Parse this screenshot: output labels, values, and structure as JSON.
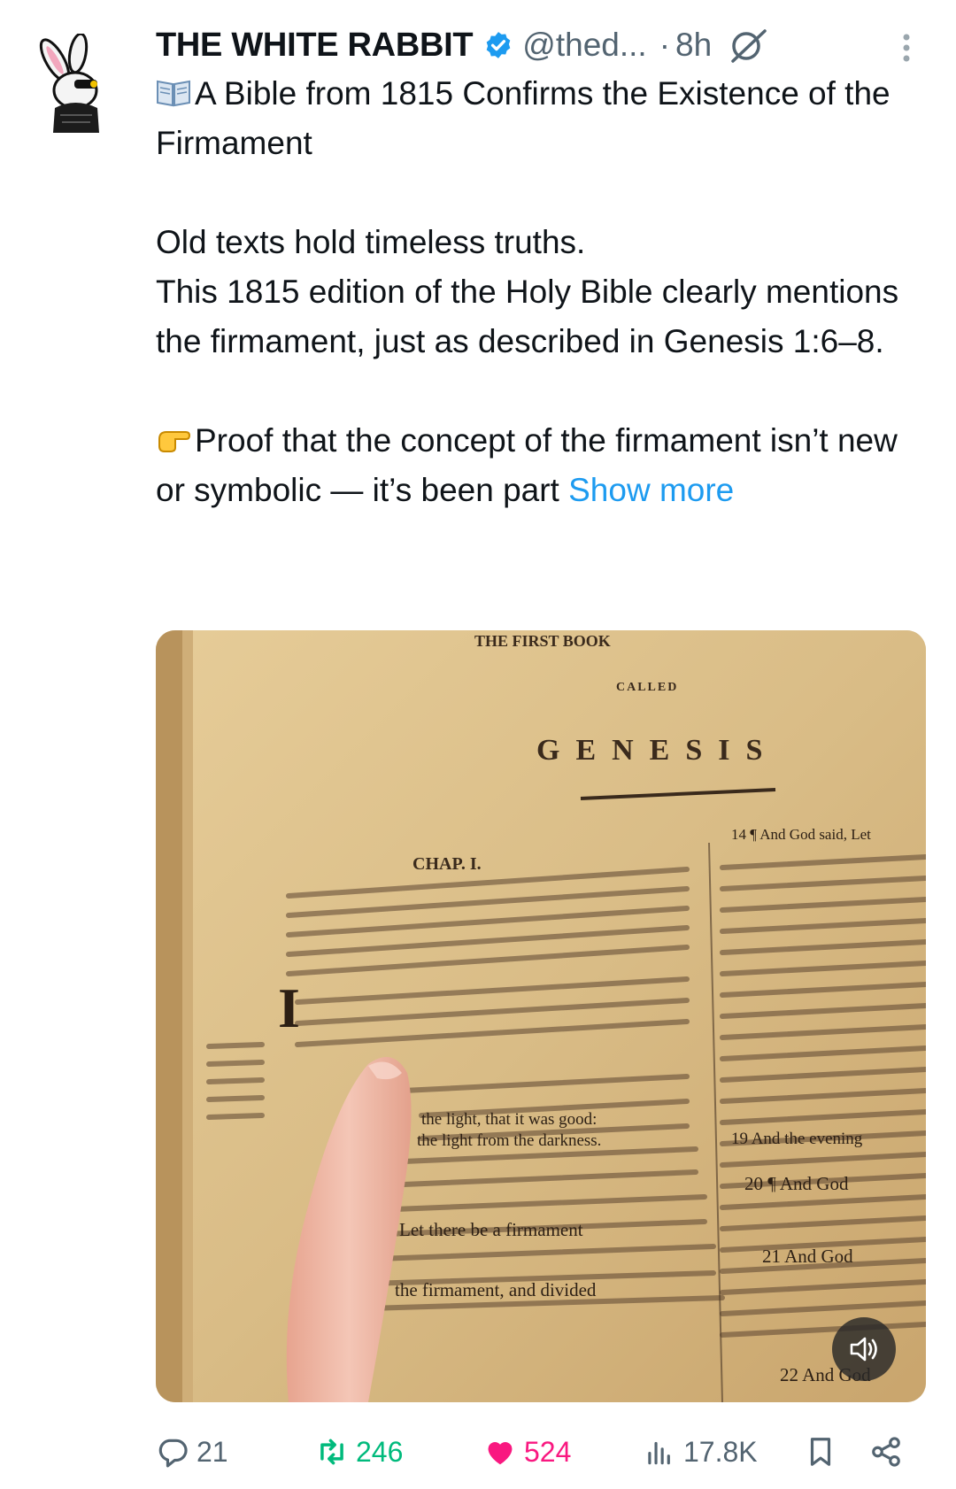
{
  "tweet": {
    "display_name": "THE WHITE RABBIT",
    "handle": "@thed...",
    "separator": "·",
    "time": "8h",
    "line1": "A Bible from 1815 Confirms the Existence of the Firmament",
    "line2": "Old texts hold timeless truths.",
    "line3": "This 1815 edition of the Holy Bible clearly mentions the firmament, just as described in Genesis 1:6–8.",
    "line4": "Proof that the concept of the firmament isn’t new or symbolic — it’s been part",
    "show_more": "Show more"
  },
  "media": {
    "page_header": "THE FIRST BOOK",
    "called": "CALLED",
    "title": "GENESIS",
    "chapter": "CHAP. I.",
    "verse_14": "14 ¶ And God said, Let",
    "verse_19": "19 And the evening",
    "verse_20": "20 ¶ And God",
    "verse_21": "21 And God",
    "verse_22": "22 And God",
    "body_left": "the light, that it was good:",
    "body_left2": "the light from the darkness.",
    "body_left3": "Let there be a firmament",
    "body_left4": "the firmament, and divided"
  },
  "actions": {
    "replies": "21",
    "retweets": "246",
    "likes": "524",
    "views": "17.8K"
  },
  "icons": {
    "verified": "verified-badge-icon",
    "grok": "grok-icon",
    "more": "more-vertical-icon",
    "book_emoji": "open-book-emoji",
    "pointing_emoji": "pointing-right-emoji",
    "mute": "speaker-icon",
    "reply": "reply-icon",
    "retweet": "retweet-icon",
    "like": "heart-icon",
    "views": "views-icon",
    "bookmark": "bookmark-icon",
    "share": "share-icon"
  },
  "colors": {
    "link": "#1d9bf0",
    "secondary": "#536471",
    "retweet": "#00ba7c",
    "like": "#f91880",
    "verified": "#1d9bf0"
  }
}
